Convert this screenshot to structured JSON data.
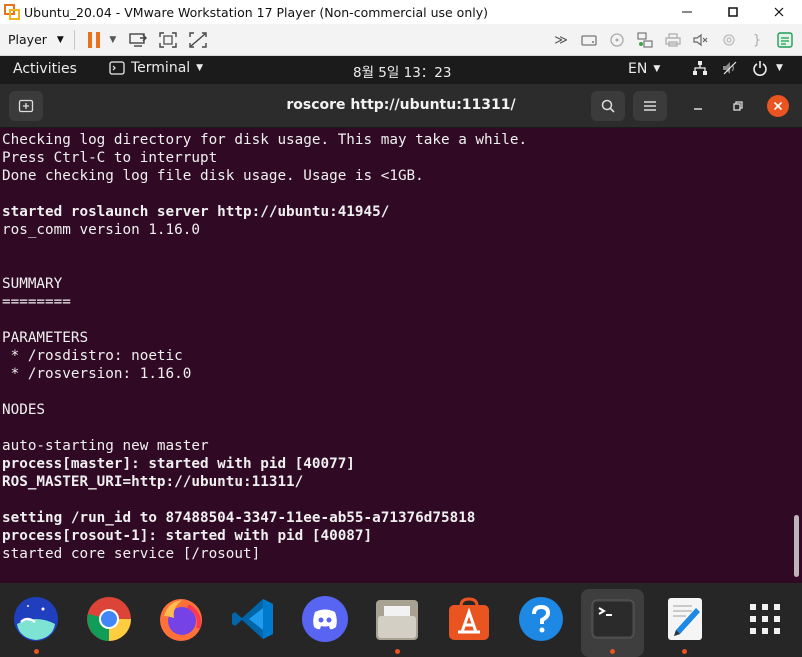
{
  "window": {
    "title": "Ubuntu_20.04 - VMware Workstation 17 Player (Non-commercial use only)",
    "minimize_icon": "minimize-icon",
    "maximize_icon": "maximize-icon",
    "close_icon": "close-icon"
  },
  "vm_toolbar": {
    "player_label": "Player",
    "icons": [
      "pause-icon",
      "send-ctrl-alt-del-icon",
      "full-screen-icon",
      "unity-icon"
    ],
    "device_icons": [
      "forward-icon",
      "hard-disk-icon",
      "cd-dvd-icon",
      "network-icon",
      "printer-icon",
      "sound-icon",
      "usb-icon",
      "serial-icon",
      "notes-icon"
    ],
    "accent_color": "#e8721c"
  },
  "gnome_bar": {
    "activities": "Activities",
    "app_name": "Terminal",
    "clock": "8월 5일  13：23",
    "language": "EN"
  },
  "terminal": {
    "title": "roscore http://ubuntu:11311/",
    "background": "#300a24",
    "lines": [
      {
        "text": "Checking log directory for disk usage. This may take a while.",
        "bold": false
      },
      {
        "text": "Press Ctrl-C to interrupt",
        "bold": false
      },
      {
        "text": "Done checking log file disk usage. Usage is <1GB.",
        "bold": false
      },
      {
        "text": "",
        "bold": false
      },
      {
        "text": "started roslaunch server http://ubuntu:41945/",
        "bold": true
      },
      {
        "text": "ros_comm version 1.16.0",
        "bold": false
      },
      {
        "text": "",
        "bold": false
      },
      {
        "text": "",
        "bold": false
      },
      {
        "text": "SUMMARY",
        "bold": false
      },
      {
        "text": "========",
        "bold": false
      },
      {
        "text": "",
        "bold": false
      },
      {
        "text": "PARAMETERS",
        "bold": false
      },
      {
        "text": " * /rosdistro: noetic",
        "bold": false
      },
      {
        "text": " * /rosversion: 1.16.0",
        "bold": false
      },
      {
        "text": "",
        "bold": false
      },
      {
        "text": "NODES",
        "bold": false
      },
      {
        "text": "",
        "bold": false
      },
      {
        "text": "auto-starting new master",
        "bold": false
      },
      {
        "text": "process[master]: started with pid [40077]",
        "bold": true
      },
      {
        "text": "ROS_MASTER_URI=http://ubuntu:11311/",
        "bold": true
      },
      {
        "text": "",
        "bold": false
      },
      {
        "text": "setting /run_id to 87488504-3347-11ee-ab55-a71376d75818",
        "bold": true
      },
      {
        "text": "process[rosout-1]: started with pid [40087]",
        "bold": true
      },
      {
        "text": "started core service [/rosout]",
        "bold": false
      }
    ]
  },
  "dock": {
    "items": [
      {
        "name": "whale-browser-icon",
        "running": true
      },
      {
        "name": "chrome-icon",
        "running": false
      },
      {
        "name": "firefox-icon",
        "running": false
      },
      {
        "name": "vscode-icon",
        "running": false
      },
      {
        "name": "discord-icon",
        "running": false
      },
      {
        "name": "files-icon",
        "running": true
      },
      {
        "name": "software-center-icon",
        "running": false
      },
      {
        "name": "help-icon",
        "running": false
      },
      {
        "name": "terminal-icon",
        "running": true
      },
      {
        "name": "text-editor-icon",
        "running": true
      },
      {
        "name": "show-apps-icon",
        "running": false
      }
    ]
  }
}
